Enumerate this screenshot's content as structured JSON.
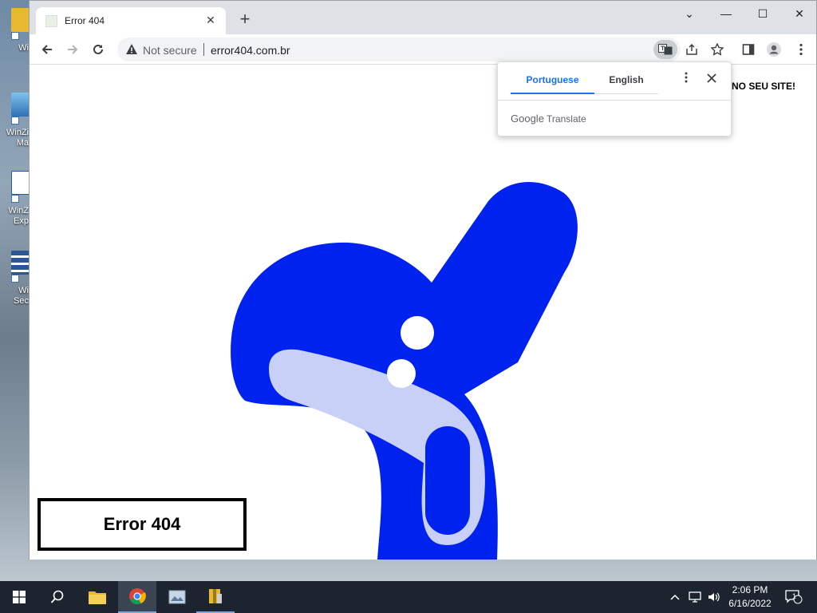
{
  "desktop": {
    "icons": [
      {
        "label": "Wi",
        "icon": "folder-archive-icon"
      },
      {
        "label": "WinZi\nMa",
        "icon": "image-app-icon"
      },
      {
        "label": "WinZ\nExp",
        "icon": "pdf-icon"
      },
      {
        "label": "Wi\nSec",
        "icon": "server-icon"
      }
    ]
  },
  "browser": {
    "tab_title": "Error 404",
    "tab_close": "✕",
    "new_tab": "+",
    "window_controls": {
      "minimize": "⌄",
      "min": "—",
      "max": "☐",
      "close": "✕"
    },
    "toolbar": {
      "security_text": "Not secure",
      "url": "error404.com.br"
    },
    "page": {
      "headline": "NO SEU SITE!",
      "error_label": "Error 404"
    },
    "translate_popup": {
      "tab_source": "Portuguese",
      "tab_target": "English",
      "brand_google": "Google",
      "brand_translate": "Translate"
    }
  },
  "taskbar": {
    "apps": [
      "start-icon",
      "search-icon",
      "file-explorer-icon",
      "chrome-icon",
      "image-viewer-icon",
      "archive-icon"
    ],
    "clock_time": "2:06 PM",
    "clock_date": "6/16/2022",
    "notification_count": "1"
  },
  "colors": {
    "art_blue": "#0022ee",
    "art_light": "#c8d0f8",
    "accent": "#1a73e8"
  }
}
